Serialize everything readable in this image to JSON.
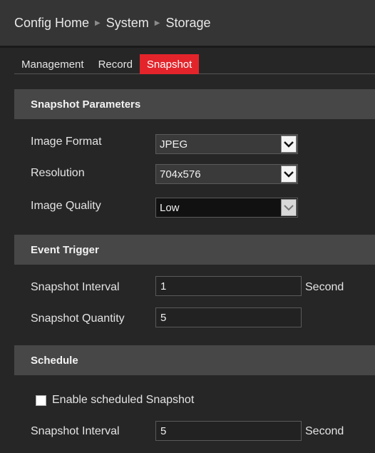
{
  "breadcrumb": {
    "items": [
      "Config Home",
      "System",
      "Storage"
    ]
  },
  "tabs": [
    {
      "label": "Management",
      "active": false
    },
    {
      "label": "Record",
      "active": false
    },
    {
      "label": "Snapshot",
      "active": true
    }
  ],
  "snapshot_parameters": {
    "title": "Snapshot Parameters",
    "image_format": {
      "label": "Image Format",
      "value": "JPEG"
    },
    "resolution": {
      "label": "Resolution",
      "value": "704x576"
    },
    "image_quality": {
      "label": "Image Quality",
      "value": "Low"
    }
  },
  "event_trigger": {
    "title": "Event Trigger",
    "interval": {
      "label": "Snapshot Interval",
      "value": "1",
      "unit": "Second"
    },
    "quantity": {
      "label": "Snapshot Quantity",
      "value": "5"
    }
  },
  "schedule": {
    "title": "Schedule",
    "enable": {
      "label": "Enable scheduled Snapshot",
      "checked": false
    },
    "interval": {
      "label": "Snapshot Interval",
      "value": "5",
      "unit": "Second"
    }
  },
  "colors": {
    "accent": "#e3242b",
    "background": "#262626",
    "section": "#474747"
  }
}
